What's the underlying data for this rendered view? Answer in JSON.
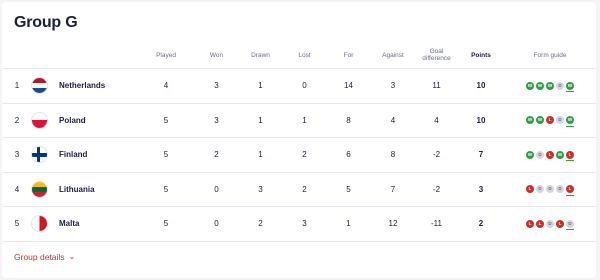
{
  "group": {
    "title": "Group G"
  },
  "columns": {
    "played": "Played",
    "won": "Won",
    "drawn": "Drawn",
    "lost": "Lost",
    "for": "For",
    "against": "Against",
    "goal_difference": "Goal difference",
    "points": "Points",
    "form_guide": "Form guide"
  },
  "rows": [
    {
      "pos": "1",
      "team": "Netherlands",
      "flag": "netherlands-flag",
      "played": "4",
      "won": "3",
      "drawn": "1",
      "lost": "0",
      "for": "14",
      "against": "3",
      "gd": "11",
      "points": "10",
      "form": [
        "W",
        "W",
        "W",
        "D",
        "W"
      ]
    },
    {
      "pos": "2",
      "team": "Poland",
      "flag": "poland-flag",
      "played": "5",
      "won": "3",
      "drawn": "1",
      "lost": "1",
      "for": "8",
      "against": "4",
      "gd": "4",
      "points": "10",
      "form": [
        "W",
        "W",
        "L",
        "D",
        "W"
      ]
    },
    {
      "pos": "3",
      "team": "Finland",
      "flag": "finland-flag",
      "played": "5",
      "won": "2",
      "drawn": "1",
      "lost": "2",
      "for": "6",
      "against": "8",
      "gd": "-2",
      "points": "7",
      "form": [
        "W",
        "D",
        "L",
        "W",
        "L"
      ]
    },
    {
      "pos": "4",
      "team": "Lithuania",
      "flag": "lithuania-flag",
      "played": "5",
      "won": "0",
      "drawn": "3",
      "lost": "2",
      "for": "5",
      "against": "7",
      "gd": "-2",
      "points": "3",
      "form": [
        "L",
        "D",
        "D",
        "D",
        "L"
      ]
    },
    {
      "pos": "5",
      "team": "Malta",
      "flag": "malta-flag",
      "played": "5",
      "won": "0",
      "drawn": "2",
      "lost": "3",
      "for": "1",
      "against": "12",
      "gd": "-11",
      "points": "2",
      "form": [
        "L",
        "L",
        "D",
        "L",
        "D"
      ]
    }
  ],
  "footer": {
    "details_label": "Group details",
    "chevron_icon": "chevron-down-icon"
  },
  "colors": {
    "win": "#2f9e44",
    "loss": "#c9302c",
    "draw": "#d6d6db",
    "accent": "#c9302c"
  }
}
